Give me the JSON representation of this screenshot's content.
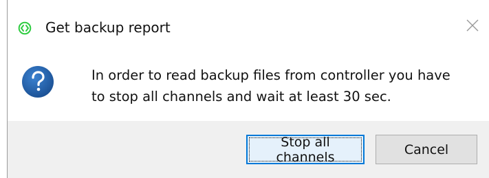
{
  "dialog": {
    "title": "Get backup report",
    "app_icon": "green-circle-arrows-icon",
    "close_icon": "close-icon",
    "message_icon": "question-icon",
    "message_lines": [
      "In order to read backup files from controller you have",
      "to stop all channels and wait at least 30 sec."
    ],
    "buttons": {
      "primary_label": "Stop all channels",
      "cancel_label": "Cancel"
    }
  },
  "colors": {
    "accent": "#0078d7",
    "app_icon_green": "#2ecc40",
    "question_blue": "#1f5fa6",
    "footer_bg": "#f0f0f0"
  }
}
